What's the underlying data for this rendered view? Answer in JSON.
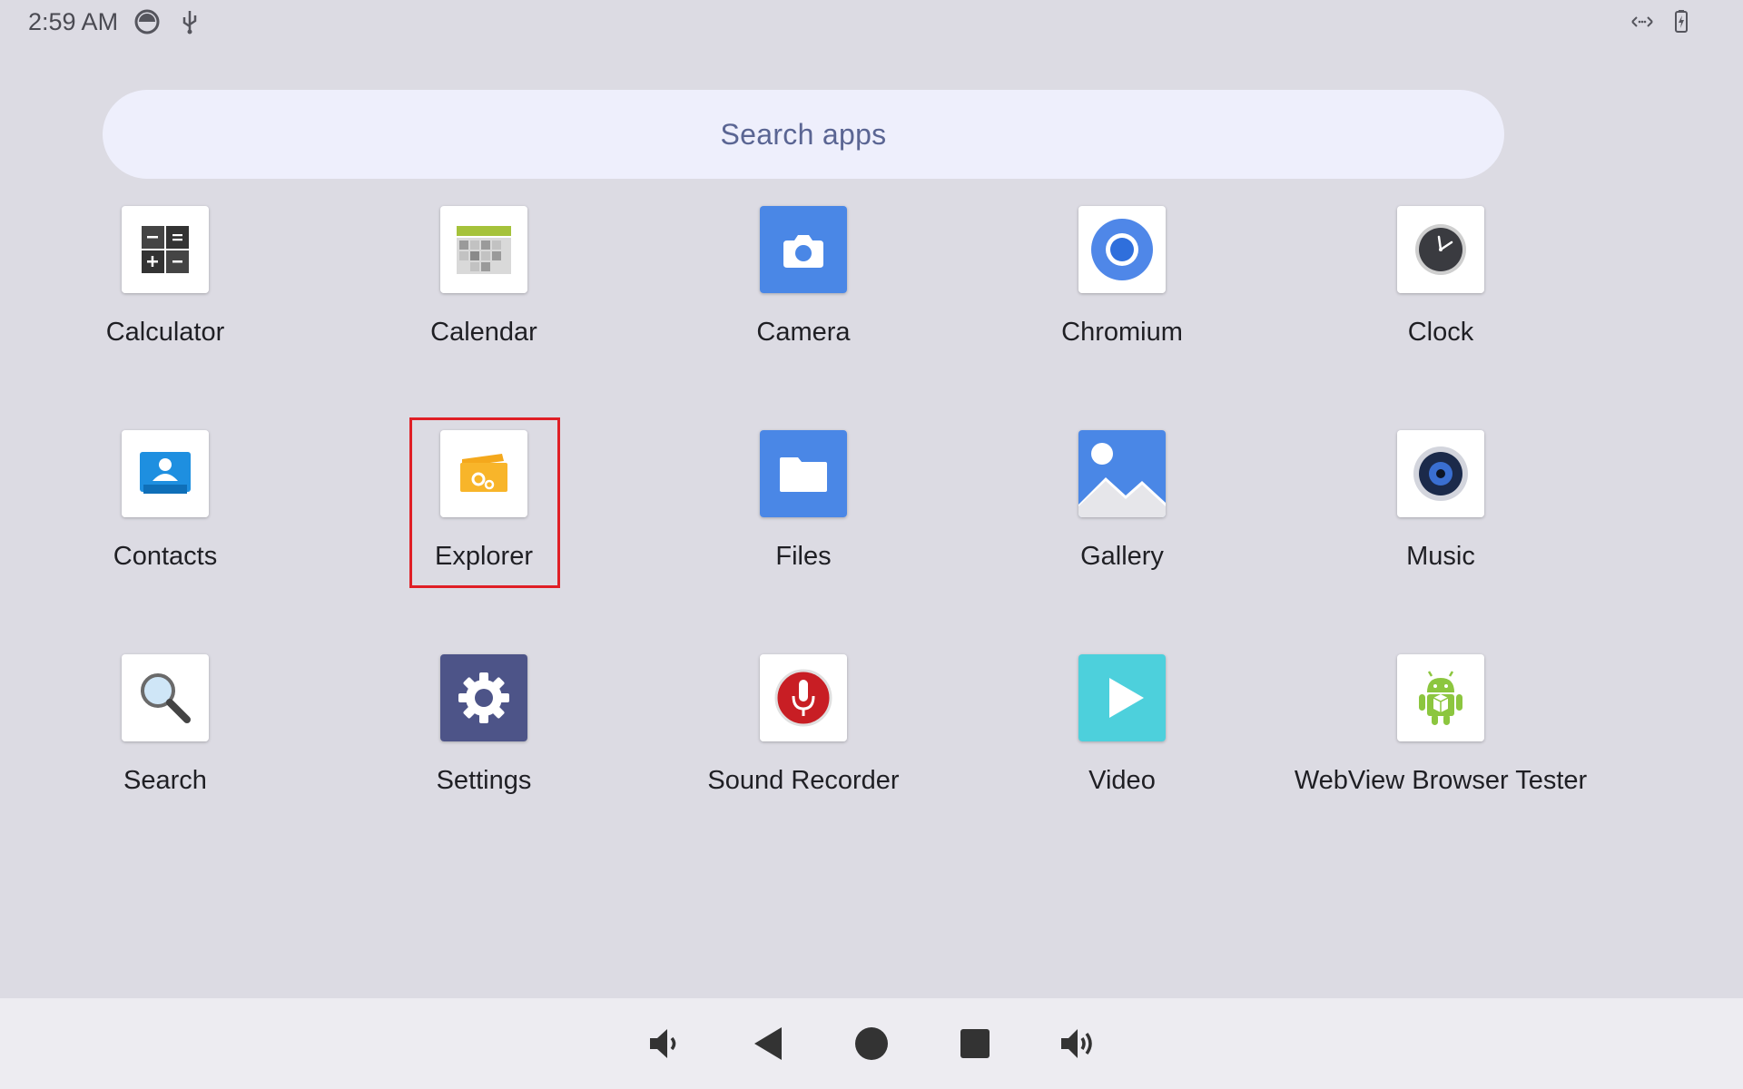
{
  "status_bar": {
    "time": "2:59 AM",
    "left_icons": [
      "data-saver-icon",
      "usb-icon"
    ],
    "right_icons": [
      "network-arrows-icon",
      "battery-charging-icon"
    ]
  },
  "search": {
    "placeholder": "Search apps"
  },
  "apps": [
    {
      "label": "Calculator",
      "icon": "calculator-icon"
    },
    {
      "label": "Calendar",
      "icon": "calendar-icon"
    },
    {
      "label": "Camera",
      "icon": "camera-icon"
    },
    {
      "label": "Chromium",
      "icon": "chromium-icon"
    },
    {
      "label": "Clock",
      "icon": "clock-icon"
    },
    {
      "label": "Contacts",
      "icon": "contacts-icon"
    },
    {
      "label": "Explorer",
      "icon": "explorer-icon",
      "highlighted": true
    },
    {
      "label": "Files",
      "icon": "files-icon"
    },
    {
      "label": "Gallery",
      "icon": "gallery-icon"
    },
    {
      "label": "Music",
      "icon": "music-icon"
    },
    {
      "label": "Search",
      "icon": "search-icon"
    },
    {
      "label": "Settings",
      "icon": "settings-icon"
    },
    {
      "label": "Sound Recorder",
      "icon": "sound-recorder-icon"
    },
    {
      "label": "Video",
      "icon": "video-icon"
    },
    {
      "label": "WebView Browser Tester",
      "icon": "webview-browser-tester-icon"
    }
  ],
  "nav_bar": {
    "buttons": [
      "volume-down-icon",
      "back-icon",
      "home-icon",
      "recents-icon",
      "volume-up-icon"
    ]
  },
  "colors": {
    "background": "#dcdbe3",
    "search_bar": "#eeeffc",
    "nav_bar": "#edecf1",
    "highlight": "#e01f26"
  }
}
